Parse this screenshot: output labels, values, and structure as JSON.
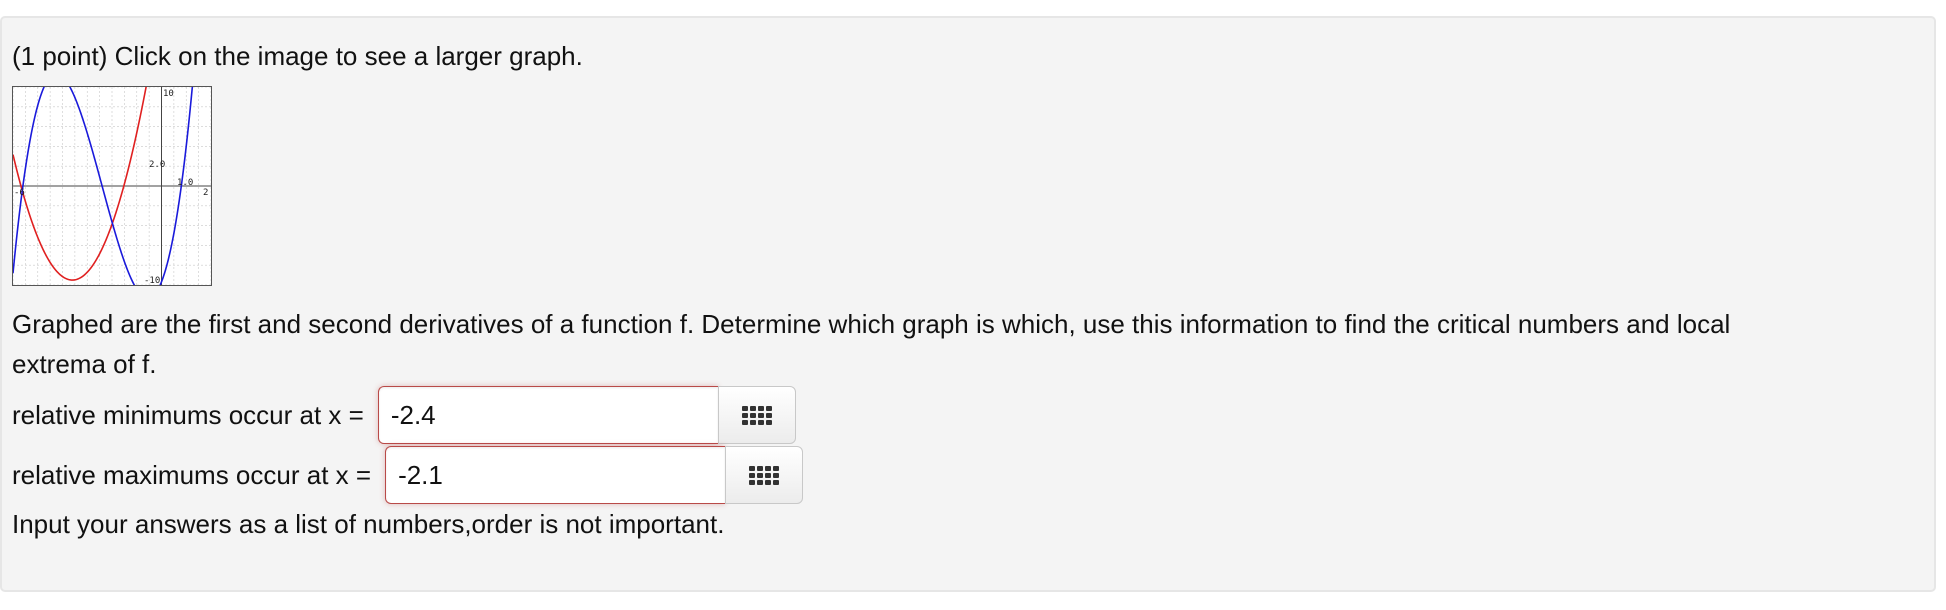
{
  "problem": {
    "header": "(1 point) Click on the image to see a larger graph.",
    "statement_line1": "Graphed are the first and second derivatives of a function f. Determine which graph is which, use this information to find the critical numbers and local",
    "statement_line2": "extrema of f.",
    "instruction": "Input your answers as a list of numbers,order is not important."
  },
  "graph": {
    "tick_labels": {
      "x_min": "-6",
      "x_max": "2",
      "y_max": "10",
      "y_min": "-10",
      "y_mid": "2.0",
      "x_mid": "1.0"
    },
    "colors": {
      "first_curve": "#e02020",
      "second_curve": "#1a1adb",
      "axis": "#444444",
      "grid": "#c8c8c8"
    }
  },
  "answers": {
    "minimums": {
      "label": "relative minimums occur at x =",
      "value": "-2.4"
    },
    "maximums": {
      "label": "relative maximums occur at x =",
      "value": "-2.1"
    },
    "equation_editor_icon": "grid-icon"
  }
}
